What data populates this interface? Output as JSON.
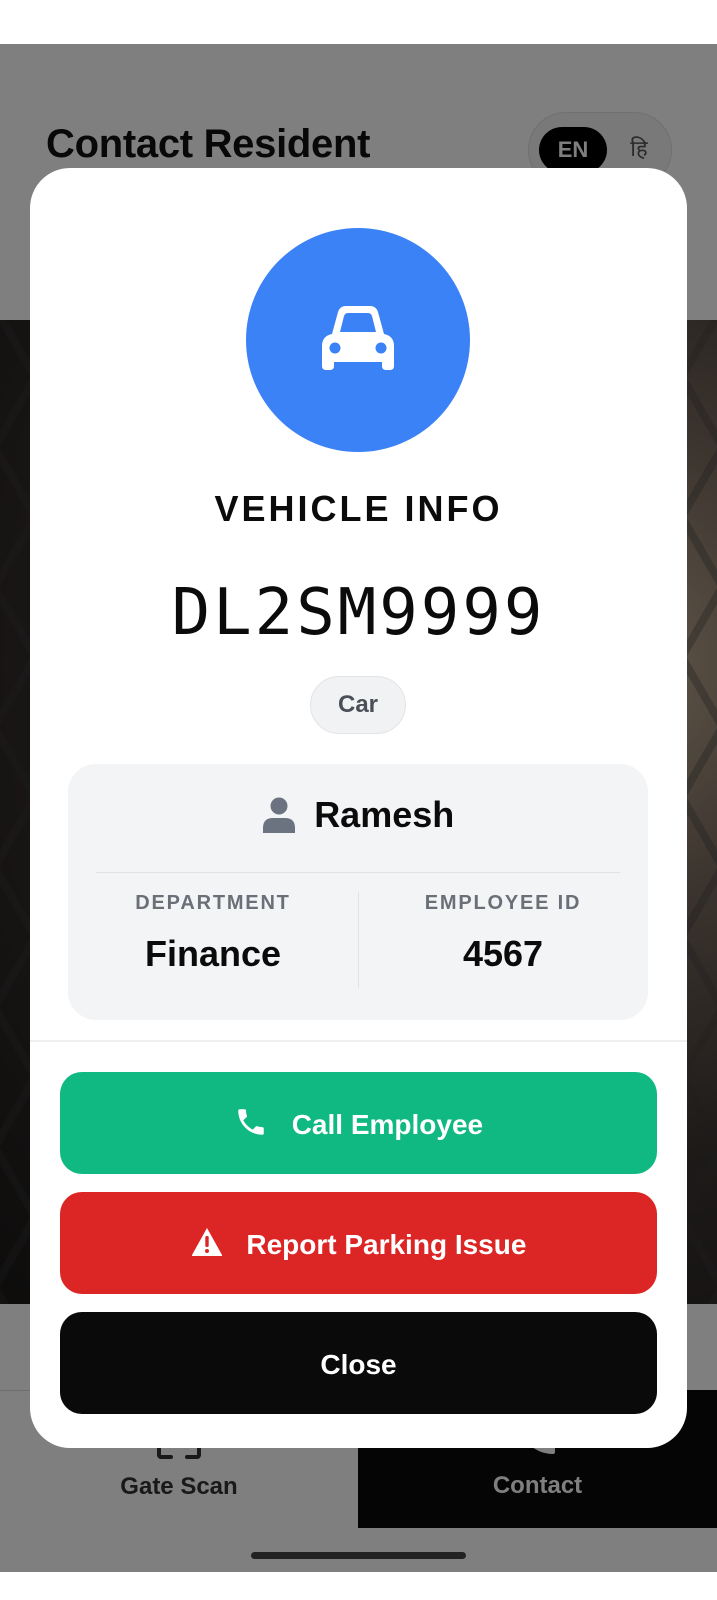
{
  "header": {
    "title": "Contact Resident",
    "lang_en": "EN",
    "lang_hi": "हि"
  },
  "nav": {
    "gate_scan_label": "Gate Scan",
    "contact_label": "Contact"
  },
  "modal": {
    "heading": "VEHICLE INFO",
    "plate_number": "DL2SM9999",
    "vehicle_type": "Car",
    "owner": {
      "name": "Ramesh",
      "department_label": "DEPARTMENT",
      "department_value": "Finance",
      "employee_id_label": "EMPLOYEE ID",
      "employee_id_value": "4567"
    },
    "buttons": {
      "call": "Call Employee",
      "report": "Report Parking Issue",
      "close": "Close"
    }
  },
  "colors": {
    "accent_blue": "#3b82f6",
    "call_green": "#10b981",
    "report_red": "#dc2626",
    "close_black": "#0a0a0a"
  },
  "icons": {
    "avatar": "car-icon",
    "owner": "person-icon",
    "call": "phone-icon",
    "report": "warning-icon",
    "gate_scan": "scan-frame-icon",
    "contact": "phone-icon"
  }
}
